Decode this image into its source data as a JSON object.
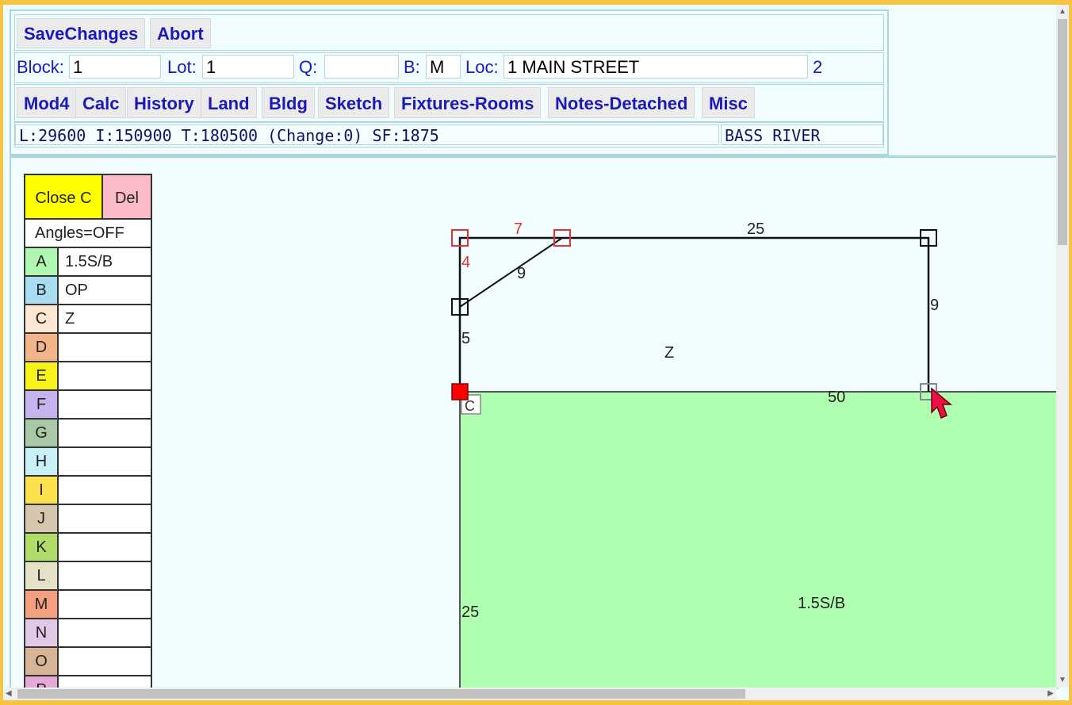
{
  "toolbar": {
    "save_label": "SaveChanges",
    "abort_label": "Abort"
  },
  "record": {
    "block_label": "Block:",
    "block_value": "1",
    "lot_label": "Lot:",
    "lot_value": "1",
    "q_label": "Q:",
    "q_value": "",
    "b_label": "B:",
    "b_value": "M",
    "loc_label": "Loc:",
    "loc_value": "1 MAIN STREET",
    "card_count": "2"
  },
  "nav": {
    "tabs": [
      "Mod4",
      "Calc",
      "History",
      "Land",
      "Bldg",
      "Sketch",
      "Fixtures-Rooms",
      "Notes-Detached",
      "Misc"
    ]
  },
  "status": {
    "values": "L:29600 I:150900 T:180500 (Change:0) SF:1875",
    "district": "BASS RIVER"
  },
  "legend": {
    "close_label": "Close C",
    "del_label": "Del",
    "angles_label": "Angles=OFF",
    "items": [
      {
        "letter": "A",
        "value": "1.5S/B",
        "color": "#b0f5b0"
      },
      {
        "letter": "B",
        "value": "OP",
        "color": "#a8dcf0"
      },
      {
        "letter": "C",
        "value": "Z",
        "color": "#fde6d2"
      },
      {
        "letter": "D",
        "value": "",
        "color": "#f4b48a"
      },
      {
        "letter": "E",
        "value": "",
        "color": "#f7f21b"
      },
      {
        "letter": "F",
        "value": "",
        "color": "#c8b4ec"
      },
      {
        "letter": "G",
        "value": "",
        "color": "#a8c8a8"
      },
      {
        "letter": "H",
        "value": "",
        "color": "#c8f0f6"
      },
      {
        "letter": "I",
        "value": "",
        "color": "#fbe24c"
      },
      {
        "letter": "J",
        "value": "",
        "color": "#d6c6ae"
      },
      {
        "letter": "K",
        "value": "",
        "color": "#b0dc6a"
      },
      {
        "letter": "L",
        "value": "",
        "color": "#e6e0c8"
      },
      {
        "letter": "M",
        "value": "",
        "color": "#f4a080"
      },
      {
        "letter": "N",
        "value": "",
        "color": "#e0c8e6"
      },
      {
        "letter": "O",
        "value": "",
        "color": "#d6b494"
      },
      {
        "letter": "P",
        "value": "",
        "color": "#e6a8d6"
      }
    ]
  },
  "sketch": {
    "dim_7": "7",
    "dim_25_top": "25",
    "dim_4": "4",
    "dim_9_diag": "9",
    "dim_9_right": "9",
    "dim_5": "5",
    "area_z": "Z",
    "dim_50": "50",
    "vertex_c": "C",
    "dim_25_left": "25",
    "area_main": "1.5S/B"
  }
}
